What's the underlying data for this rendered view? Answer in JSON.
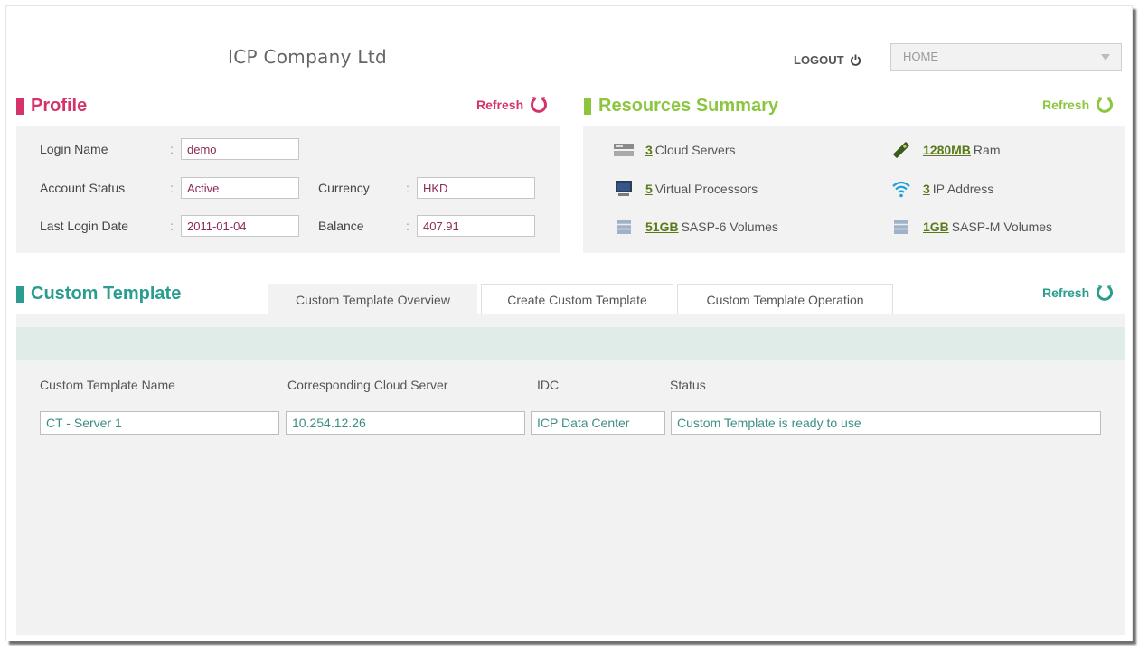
{
  "header": {
    "company": "ICP Company Ltd",
    "logout_label": "LOGOUT",
    "nav_select": "HOME"
  },
  "colors": {
    "profile_accent": "#d6336c",
    "resources_accent": "#8cc63f",
    "template_accent": "#2a9d8f"
  },
  "profile": {
    "title": "Profile",
    "refresh_label": "Refresh",
    "login_name_label": "Login Name",
    "login_name": "demo",
    "account_status_label": "Account Status",
    "account_status": "Active",
    "currency_label": "Currency",
    "currency": "HKD",
    "last_login_label": "Last Login Date",
    "last_login": "2011-01-04",
    "balance_label": "Balance",
    "balance": "407.91",
    "colon": ":"
  },
  "resources": {
    "title": "Resources Summary",
    "refresh_label": "Refresh",
    "items": [
      {
        "value": "3",
        "label": "Cloud Servers",
        "icon": "server-icon"
      },
      {
        "value": "1280MB",
        "label": "Ram",
        "icon": "ram-icon"
      },
      {
        "value": "5",
        "label": "Virtual Processors",
        "icon": "monitor-icon"
      },
      {
        "value": "3",
        "label": "IP Address",
        "icon": "wifi-icon"
      },
      {
        "value": "51GB",
        "label": "SASP-6 Volumes",
        "icon": "storage-icon"
      },
      {
        "value": "1GB",
        "label": "SASP-M Volumes",
        "icon": "storage-icon"
      }
    ]
  },
  "template": {
    "title": "Custom Template",
    "refresh_label": "Refresh",
    "tabs": [
      {
        "label": "Custom Template Overview"
      },
      {
        "label": "Create Custom Template"
      },
      {
        "label": "Custom Template Operation"
      }
    ],
    "columns": [
      "Custom Template Name",
      "Corresponding Cloud Server",
      "IDC",
      "Status"
    ],
    "rows": [
      [
        "CT - Server 1",
        "10.254.12.26",
        "ICP Data Center",
        "Custom Template is ready to use"
      ]
    ]
  }
}
